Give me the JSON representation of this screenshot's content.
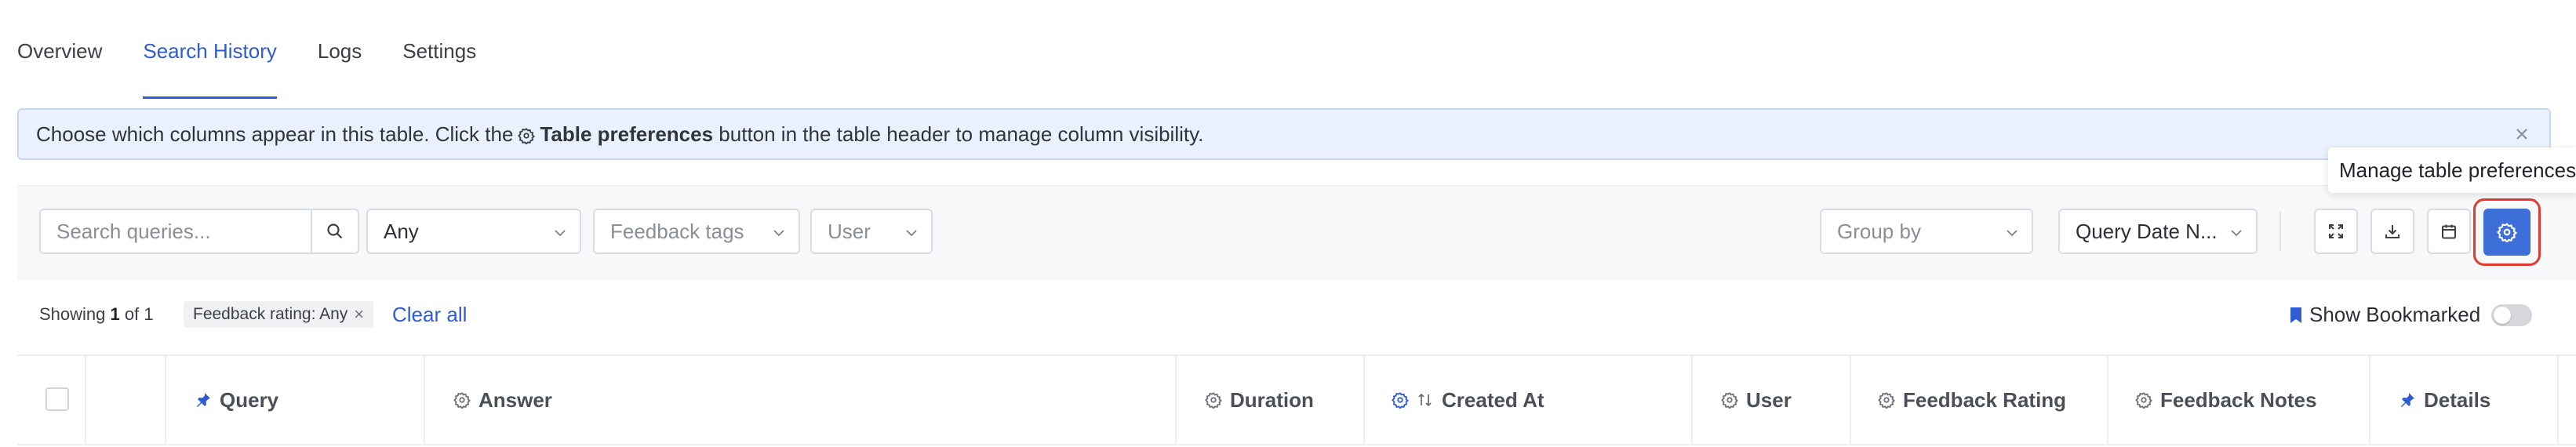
{
  "tabs": [
    {
      "label": "Overview"
    },
    {
      "label": "Search History"
    },
    {
      "label": "Logs"
    },
    {
      "label": "Settings"
    }
  ],
  "active_tab": "Search History",
  "banner": {
    "text_before": "Choose which columns appear in this table. Click the",
    "bold": "Table preferences",
    "text_after": "button in the table header to manage column visibility."
  },
  "tooltip": {
    "text": "Manage table preferences"
  },
  "toolbar": {
    "search_placeholder": "Search queries...",
    "any_value": "Any",
    "feedback_tags_placeholder": "Feedback tags",
    "user_placeholder": "User",
    "group_by_placeholder": "Group by",
    "query_date_value": "Query Date N..."
  },
  "summary": {
    "showing": "Showing",
    "count": "1",
    "of": "of 1",
    "chip": "Feedback rating: Any",
    "clear_all": "Clear all",
    "show_bookmarked": "Show Bookmarked"
  },
  "columns": [
    {
      "label": "Query",
      "icon": "pin-icon"
    },
    {
      "label": "Answer",
      "icon": "gear-icon"
    },
    {
      "label": "Duration",
      "icon": "gear-icon"
    },
    {
      "label": "Created At",
      "icon": "gear-icon"
    },
    {
      "label": "User",
      "icon": "gear-icon"
    },
    {
      "label": "Feedback Rating",
      "icon": "gear-icon"
    },
    {
      "label": "Feedback Notes",
      "icon": "gear-icon"
    },
    {
      "label": "Details",
      "icon": "pin-icon"
    }
  ],
  "colors": {
    "accent": "#2f5bd3",
    "prefs_button": "#3e6ed8",
    "highlight_ring": "#e13a2e",
    "banner_bg": "#eaf1fc"
  }
}
